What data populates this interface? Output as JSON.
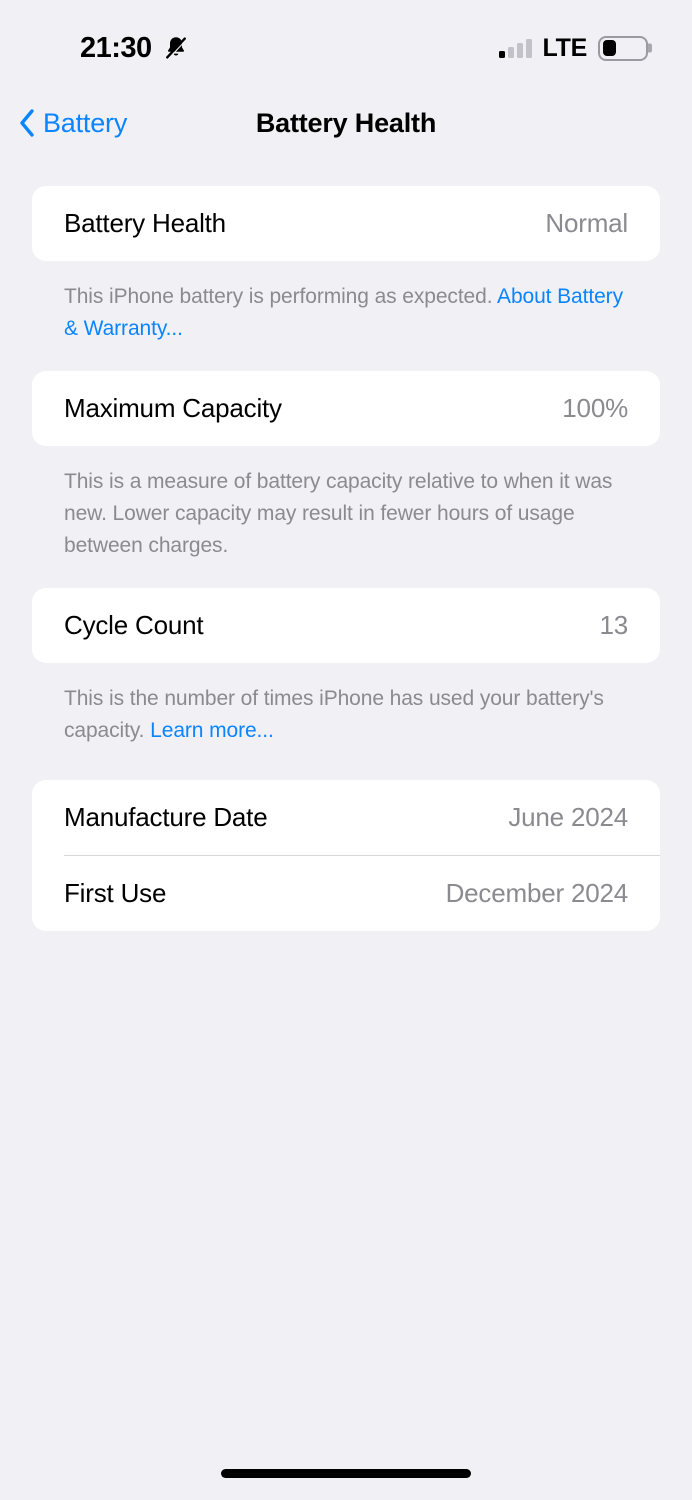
{
  "status_bar": {
    "time": "21:30",
    "silent_icon": "bell-slash-icon",
    "signal_icon": "cellular-signal-icon",
    "carrier": "LTE",
    "battery_icon": "battery-low-icon"
  },
  "nav": {
    "back_label": "Battery",
    "back_icon": "chevron-left-icon",
    "title": "Battery Health"
  },
  "sections": [
    {
      "rows": [
        {
          "label": "Battery Health",
          "value": "Normal"
        }
      ],
      "footnote": {
        "text": "This iPhone battery is performing as expected. ",
        "link": "About Battery & Warranty..."
      }
    },
    {
      "rows": [
        {
          "label": "Maximum Capacity",
          "value": "100%"
        }
      ],
      "footnote": {
        "text": "This is a measure of battery capacity relative to when it was new. Lower capacity may result in fewer hours of usage between charges.",
        "link": ""
      }
    },
    {
      "rows": [
        {
          "label": "Cycle Count",
          "value": "13"
        }
      ],
      "footnote": {
        "text": "This is the number of times iPhone has used your battery's capacity. ",
        "link": "Learn more..."
      }
    },
    {
      "rows": [
        {
          "label": "Manufacture Date",
          "value": "June 2024"
        },
        {
          "label": "First Use",
          "value": "December 2024"
        }
      ],
      "footnote": null
    }
  ],
  "colors": {
    "background": "#f1f1f5",
    "card": "#ffffff",
    "accent": "#0a84ff",
    "secondary_text": "#8a8a8f",
    "primary_text": "#000000",
    "separator": "#d8d8dc"
  },
  "home_indicator": "home-indicator"
}
